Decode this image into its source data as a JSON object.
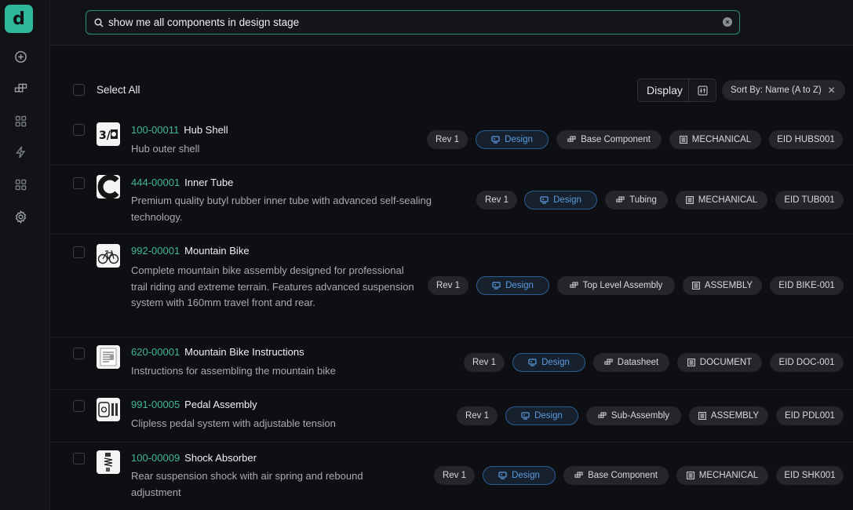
{
  "app": {
    "logo_letter": "d",
    "accent_color": "#2fb79a"
  },
  "sidebar": {
    "icons": [
      "plus-circle-icon",
      "components-icon",
      "grid-icon",
      "bolt-icon",
      "grid-icon",
      "gear-icon"
    ]
  },
  "search": {
    "value": "show me all components in design stage"
  },
  "toolbar": {
    "select_all_label": "Select All",
    "display_label": "Display",
    "sort_label": "Sort By: Name (A to Z)"
  },
  "rows": [
    {
      "part_number": "100-00011",
      "name": "Hub Shell",
      "description": "Hub outer shell",
      "thumbnail": "hub-shell-thumbnail",
      "revision": "Rev 1",
      "status": "Design",
      "category": "Base Component",
      "type": "MECHANICAL",
      "eid": "EID HUBS001"
    },
    {
      "part_number": "444-00001",
      "name": "Inner Tube",
      "description": "Premium quality butyl rubber inner tube with advanced self-sealing technology.",
      "thumbnail": "inner-tube-thumbnail",
      "revision": "Rev 1",
      "status": "Design",
      "category": "Tubing",
      "type": "MECHANICAL",
      "eid": "EID TUB001"
    },
    {
      "part_number": "992-00001",
      "name": "Mountain Bike",
      "description": "Complete mountain bike assembly designed for professional trail riding and extreme terrain. Features advanced suspension system with 160mm travel front and rear.",
      "thumbnail": "bicycle-thumbnail",
      "revision": "Rev 1",
      "status": "Design",
      "category": "Top Level Assembly",
      "type": "ASSEMBLY",
      "eid": "EID BIKE-001"
    },
    {
      "part_number": "620-00001",
      "name": "Mountain Bike Instructions",
      "description": "Instructions for assembling the mountain bike",
      "thumbnail": "document-thumbnail",
      "revision": "Rev 1",
      "status": "Design",
      "category": "Datasheet",
      "type": "DOCUMENT",
      "eid": "EID DOC-001"
    },
    {
      "part_number": "991-00005",
      "name": "Pedal Assembly",
      "description": "Clipless pedal system with adjustable tension",
      "thumbnail": "pedal-thumbnail",
      "revision": "Rev 1",
      "status": "Design",
      "category": "Sub-Assembly",
      "type": "ASSEMBLY",
      "eid": "EID PDL001"
    },
    {
      "part_number": "100-00009",
      "name": "Shock Absorber",
      "description": "Rear suspension shock with air spring and rebound adjustment",
      "thumbnail": "shock-absorber-thumbnail",
      "revision": "Rev 1",
      "status": "Design",
      "category": "Base Component",
      "type": "MECHANICAL",
      "eid": "EID SHK001"
    }
  ]
}
